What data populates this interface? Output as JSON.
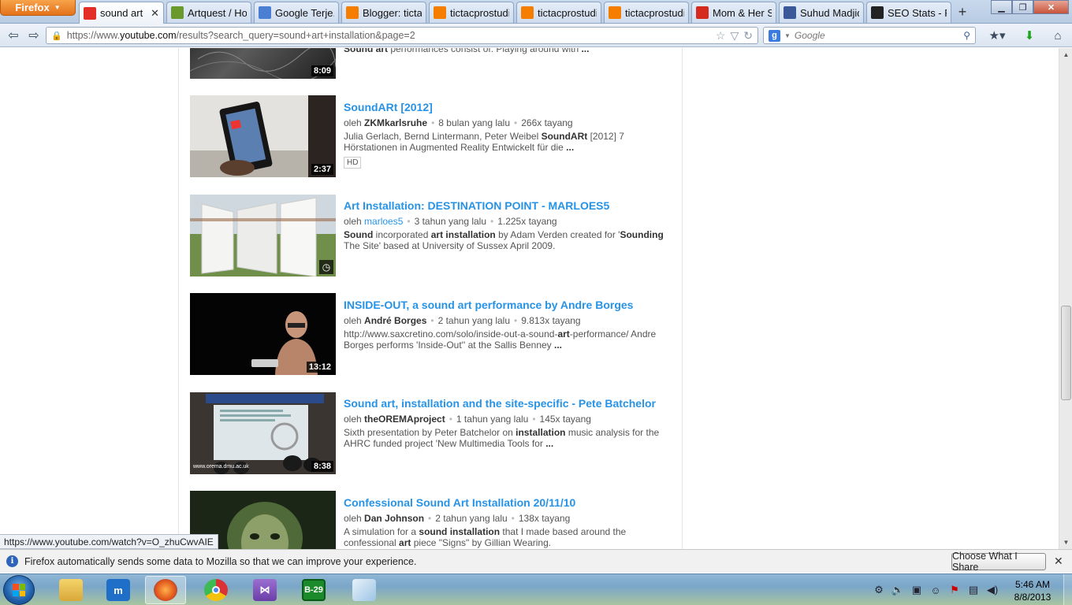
{
  "browser": {
    "firefox_menu": "Firefox",
    "tabs": [
      {
        "label": "sound art i...",
        "icon": "youtube-icon",
        "color": "#e52d27",
        "active": true
      },
      {
        "label": "Artquest / Ho...",
        "icon": "question-icon",
        "color": "#6a9a2c"
      },
      {
        "label": "Google Terje...",
        "icon": "google-translate-icon",
        "color": "#4a7fd4"
      },
      {
        "label": "Blogger: ticta...",
        "icon": "blogger-icon",
        "color": "#f57d00"
      },
      {
        "label": "tictacprostudio",
        "icon": "blogger-icon",
        "color": "#f57d00"
      },
      {
        "label": "tictacprostudio",
        "icon": "blogger-icon",
        "color": "#f57d00"
      },
      {
        "label": "tictacprostudio",
        "icon": "blogger-icon",
        "color": "#f57d00"
      },
      {
        "label": "Mom & Her S...",
        "icon": "red-cross-icon",
        "color": "#d52b1e"
      },
      {
        "label": "Suhud Madjid",
        "icon": "facebook-icon",
        "color": "#3b5998"
      },
      {
        "label": "SEO Stats - Po...",
        "icon": "seo-stats-icon",
        "color": "#222222"
      }
    ],
    "url_prefix": "https://www.",
    "url_domain": "youtube.com",
    "url_rest": "/results?search_query=sound+art+installation&page=2",
    "search_placeholder": "Google"
  },
  "partial_top": {
    "duration": "8:09",
    "desc_bold": "Sound art",
    "desc_rest": " performances consist of: Playing around with ",
    "desc_end": "..."
  },
  "results": [
    {
      "title": "SoundARt [2012]",
      "by_prefix": "oleh",
      "channel": "ZKMkarlsruhe",
      "age": "8 bulan yang lalu",
      "views": "266x tayang",
      "desc_parts": [
        {
          "t": "Julia Gerlach, Bernd Lintermann, Peter Weibel ",
          "b": false
        },
        {
          "t": "SoundARt",
          "b": true
        },
        {
          "t": " [2012] 7 Hörstationen in Augmented Reality Entwickelt für die ",
          "b": false
        },
        {
          "t": "...",
          "b": true
        }
      ],
      "duration": "2:37",
      "badge": "HD"
    },
    {
      "title": "Art Installation: DESTINATION POINT - MARLOES5",
      "by_prefix": "oleh",
      "channel": "marloes5",
      "age": "3 tahun yang lalu",
      "views": "1.225x tayang",
      "desc_parts": [
        {
          "t": "Sound",
          "b": true
        },
        {
          "t": " incorporated ",
          "b": false
        },
        {
          "t": "art installation",
          "b": true
        },
        {
          "t": " by Adam Verden created for '",
          "b": false
        },
        {
          "t": "Sounding",
          "b": true
        },
        {
          "t": " The Site' based at University of Sussex April 2009.",
          "b": false
        }
      ]
    },
    {
      "title": "INSIDE-OUT, a sound art performance by Andre Borges",
      "by_prefix": "oleh",
      "channel": "André Borges",
      "age": "2 tahun yang lalu",
      "views": "9.813x tayang",
      "desc_parts": [
        {
          "t": "http://www.saxcretino.com/solo/inside-out-a-sound-",
          "b": false
        },
        {
          "t": "art",
          "b": true
        },
        {
          "t": "-performance/ Andre Borges performs 'Inside-Out'' at the Sallis Benney ",
          "b": false
        },
        {
          "t": "...",
          "b": true
        }
      ],
      "duration": "13:12"
    },
    {
      "title": "Sound art, installation and the site-specific - Pete Batchelor",
      "by_prefix": "oleh",
      "channel": "theOREMAproject",
      "age": "1 tahun yang lalu",
      "views": "145x tayang",
      "desc_parts": [
        {
          "t": "Sixth presentation by Peter Batchelor on ",
          "b": false
        },
        {
          "t": "installation",
          "b": true
        },
        {
          "t": " music analysis for the AHRC funded project 'New Multimedia Tools for ",
          "b": false
        },
        {
          "t": "...",
          "b": true
        }
      ],
      "duration": "8:38",
      "thumb_caption": "www.orema.dmu.ac.uk"
    },
    {
      "title": "Confessional Sound Art Installation 20/11/10",
      "by_prefix": "oleh",
      "channel": "Dan Johnson",
      "age": "2 tahun yang lalu",
      "views": "138x tayang",
      "desc_parts": [
        {
          "t": "A simulation for a ",
          "b": false
        },
        {
          "t": "sound installation",
          "b": true
        },
        {
          "t": " that I made based around the confessional ",
          "b": false
        },
        {
          "t": "art",
          "b": true
        },
        {
          "t": " piece \"Signs\" by Gillian Wearing.",
          "b": false
        }
      ]
    }
  ],
  "status_link": "https://www.youtube.com/watch?v=O_zhuCwvAIE",
  "notification": {
    "message": "Firefox automatically sends some data to Mozilla so that we can improve your experience.",
    "button": "Choose What I Share"
  },
  "taskbar": {
    "bm_label": "B-29",
    "time": "5:46 AM",
    "date": "8/8/2013"
  }
}
